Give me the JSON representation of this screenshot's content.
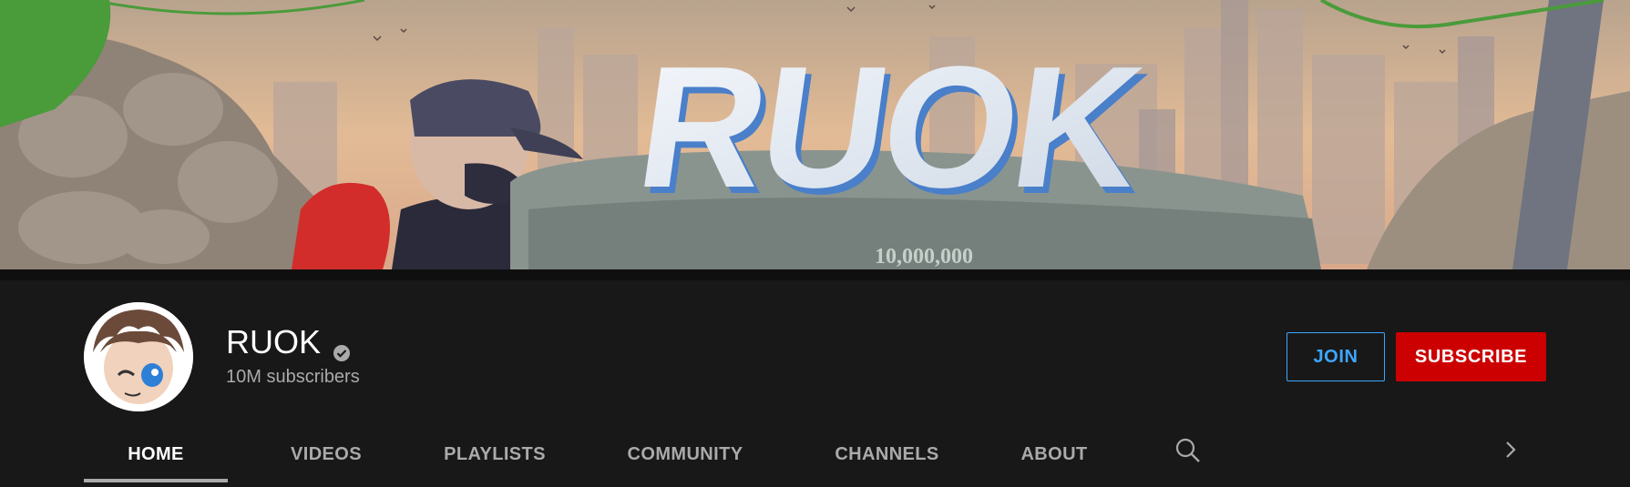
{
  "banner": {
    "title": "RUOK",
    "plaque_text": "10,000,000"
  },
  "channel": {
    "name": "RUOK",
    "subscribers": "10M subscribers",
    "verified_icon": "verified-check-icon"
  },
  "buttons": {
    "join": "JOIN",
    "subscribe": "SUBSCRIBE"
  },
  "tabs": [
    {
      "label": "HOME",
      "active": true
    },
    {
      "label": "VIDEOS",
      "active": false
    },
    {
      "label": "PLAYLISTS",
      "active": false
    },
    {
      "label": "COMMUNITY",
      "active": false
    },
    {
      "label": "CHANNELS",
      "active": false
    },
    {
      "label": "ABOUT",
      "active": false
    }
  ],
  "icons": {
    "search": "search-icon",
    "next": "chevron-right-icon"
  },
  "colors": {
    "background": "#181818",
    "join_accent": "#3ea6ff",
    "subscribe": "#cc0000",
    "tab_inactive": "#aaaaaa",
    "tab_active": "#ffffff"
  }
}
